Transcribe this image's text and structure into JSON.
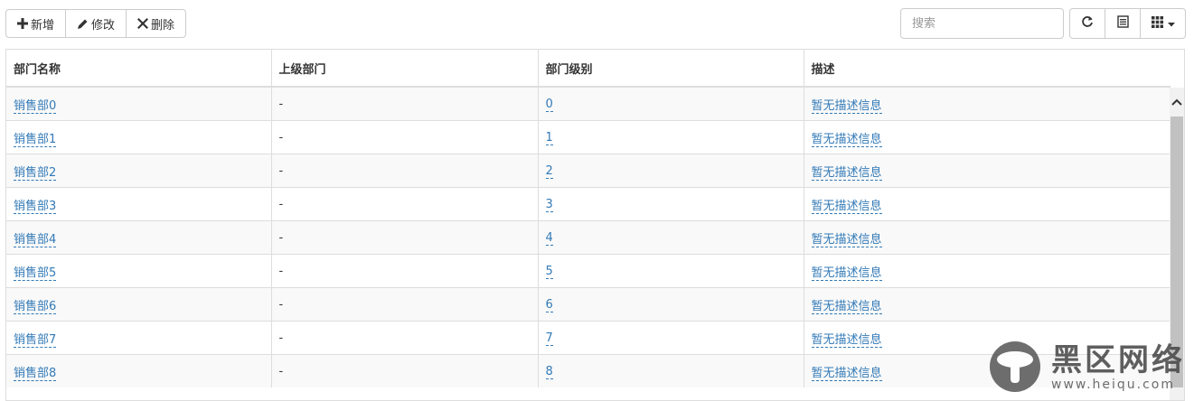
{
  "toolbar": {
    "add_label": "新增",
    "edit_label": "修改",
    "delete_label": "删除"
  },
  "search": {
    "placeholder": "搜索"
  },
  "table": {
    "headers": [
      "部门名称",
      "上级部门",
      "部门级别",
      "描述"
    ],
    "rows": [
      {
        "name": "销售部0",
        "parent": "-",
        "level": "0",
        "desc": "暂无描述信息"
      },
      {
        "name": "销售部1",
        "parent": "-",
        "level": "1",
        "desc": "暂无描述信息"
      },
      {
        "name": "销售部2",
        "parent": "-",
        "level": "2",
        "desc": "暂无描述信息"
      },
      {
        "name": "销售部3",
        "parent": "-",
        "level": "3",
        "desc": "暂无描述信息"
      },
      {
        "name": "销售部4",
        "parent": "-",
        "level": "4",
        "desc": "暂无描述信息"
      },
      {
        "name": "销售部5",
        "parent": "-",
        "level": "5",
        "desc": "暂无描述信息"
      },
      {
        "name": "销售部6",
        "parent": "-",
        "level": "6",
        "desc": "暂无描述信息"
      },
      {
        "name": "销售部7",
        "parent": "-",
        "level": "7",
        "desc": "暂无描述信息"
      },
      {
        "name": "销售部8",
        "parent": "-",
        "level": "8",
        "desc": "暂无描述信息"
      }
    ]
  },
  "watermark": {
    "title": "黑区网络",
    "url": "www.heiqu.com"
  },
  "colors": {
    "link": "#337ab7",
    "border": "#dddddd",
    "stripe": "#f9f9f9"
  }
}
